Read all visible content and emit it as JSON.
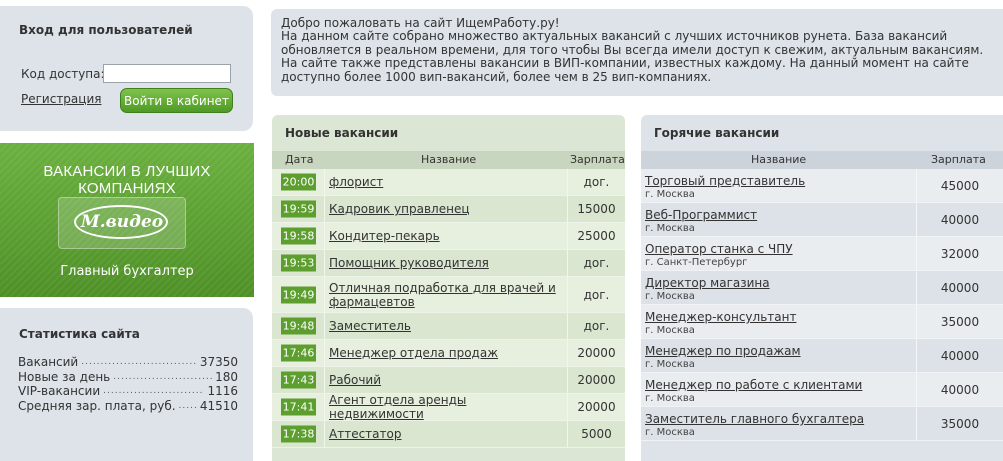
{
  "login": {
    "title": "Вход для пользователей",
    "code_label": "Код доступа:",
    "code_value": "",
    "register_link": "Регистрация",
    "submit_label": "Войти в кабинет"
  },
  "promo": {
    "title": "ВАКАНСИИ В ЛУЧШИХ КОМПАНИЯХ",
    "logo_text": "М.видео",
    "job_title": "Главный бухгалтер"
  },
  "stats": {
    "title": "Статистика сайта",
    "rows": [
      {
        "label": "Вакансий",
        "value": "37350"
      },
      {
        "label": "Новые за день",
        "value": "180"
      },
      {
        "label": "VIP-вакансии",
        "value": "1116"
      },
      {
        "label": "Средняя зар. плата, руб.",
        "value": "41510"
      }
    ]
  },
  "welcome": {
    "heading": "Добро пожаловать на сайт ИщемРаботу.ру!",
    "text": "На данном сайте собрано множество актуальных вакансий с лучших источников рунета. База вакансий обновляется в реальном времени, для того чтобы Вы всегда имели доступ к свежим, актуальным вакансиям. На сайте также представлены вакансии в ВИП-компании, известных каждому. На данный момент на сайте доступно более 1000 вип-вакансий, более чем в 25 вип-компаниях."
  },
  "new_vacancies": {
    "title": "Новые вакансии",
    "headers": {
      "date": "Дата",
      "name": "Название",
      "salary": "Зарплата"
    },
    "rows": [
      {
        "time": "20:00",
        "name": "флорист",
        "salary": "дог."
      },
      {
        "time": "19:59",
        "name": "Кадровик управленец",
        "salary": "15000"
      },
      {
        "time": "19:58",
        "name": "Кондитер-пекарь",
        "salary": "25000"
      },
      {
        "time": "19:53",
        "name": "Помощник руководителя",
        "salary": "дог."
      },
      {
        "time": "19:49",
        "name": "Отличная подработка для врачей и фармацевтов",
        "salary": "дог."
      },
      {
        "time": "19:48",
        "name": "Заместитель",
        "salary": "дог."
      },
      {
        "time": "17:46",
        "name": "Менеджер отдела продаж",
        "salary": "20000"
      },
      {
        "time": "17:43",
        "name": "Рабочий",
        "salary": "20000"
      },
      {
        "time": "17:41",
        "name": "Агент отдела аренды недвижимости",
        "salary": "20000"
      },
      {
        "time": "17:38",
        "name": "Аттестатор",
        "salary": "5000"
      }
    ]
  },
  "hot_vacancies": {
    "title": "Горячие вакансии",
    "headers": {
      "name": "Название",
      "salary": "Зарплата"
    },
    "rows": [
      {
        "name": "Торговый представитель",
        "city": "г. Москва",
        "salary": "45000"
      },
      {
        "name": "Веб-Программист",
        "city": "г. Москва",
        "salary": "40000"
      },
      {
        "name": "Оператор станка с ЧПУ",
        "city": "г. Санкт-Петербург",
        "salary": "32000"
      },
      {
        "name": "Директор магазина",
        "city": "г. Москва",
        "salary": "40000"
      },
      {
        "name": "Менеджер-консультант",
        "city": "г. Москва",
        "salary": "35000"
      },
      {
        "name": "Менеджер по продажам",
        "city": "г. Москва",
        "salary": "40000"
      },
      {
        "name": "Менеджер по работе с клиентами",
        "city": "г. Москва",
        "salary": "40000"
      },
      {
        "name": "Заместитель главного бухгалтера",
        "city": "г. Москва",
        "salary": "35000"
      }
    ]
  }
}
